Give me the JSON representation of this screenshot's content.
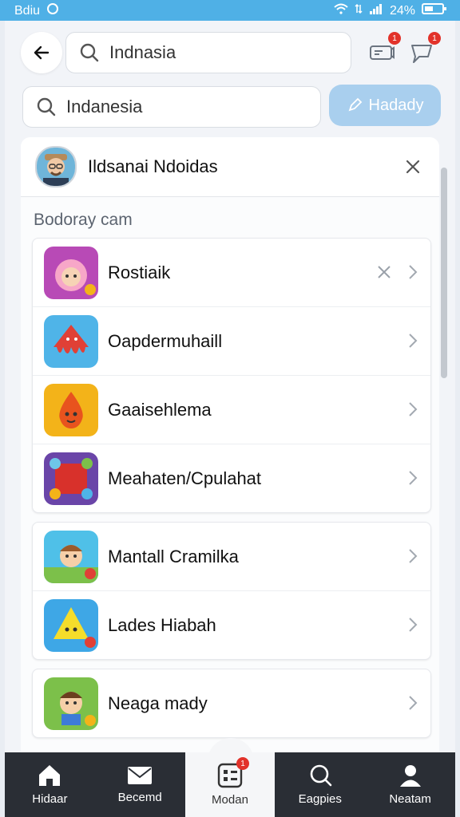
{
  "status_bar": {
    "carrier": "Bdiu",
    "battery": "24%"
  },
  "header": {
    "search_primary": {
      "value": "Indnasia",
      "placeholder": "Indnasia"
    },
    "search_secondary": {
      "value": "Indanesia",
      "placeholder": "Indanesia"
    },
    "action_button": "Hadady",
    "badges": {
      "inbox": "1",
      "notifications": "1"
    }
  },
  "user": {
    "name": "Ildsanai Ndoidas"
  },
  "section": {
    "title": "Bodoray cam"
  },
  "apps_group1": [
    {
      "label": "Rostiaik",
      "icon": "girl-app-icon",
      "color": "#b84ab6",
      "has_remove": true
    },
    {
      "label": "Oapdermuhaill",
      "icon": "squid-app-icon",
      "color": "#4fb4e8",
      "has_remove": false
    },
    {
      "label": "Gaaisehlema",
      "icon": "drop-app-icon",
      "color": "#f3b319",
      "has_remove": false
    },
    {
      "label": "Meahaten/Cpulahat",
      "icon": "gem-app-icon",
      "color": "#6a45a8",
      "has_remove": false
    }
  ],
  "apps_group2": [
    {
      "label": "Mantall Cramilka",
      "icon": "boy-app-icon",
      "color": "#4fc0e8",
      "has_remove": false
    },
    {
      "label": "Lades Hiabah",
      "icon": "triangle-app-icon",
      "color": "#3ea7e6",
      "has_remove": false
    }
  ],
  "apps_group3": [
    {
      "label": "Neaga mady",
      "icon": "kid-app-icon",
      "color": "#7cc04a",
      "has_remove": false
    }
  ],
  "bottom_nav": [
    {
      "label": "Hidaar",
      "icon": "home-icon"
    },
    {
      "label": "Becemd",
      "icon": "mail-icon"
    },
    {
      "label": "Modan",
      "icon": "grid-icon",
      "badge": "1"
    },
    {
      "label": "Eagpies",
      "icon": "search-icon"
    },
    {
      "label": "Neatam",
      "icon": "user-icon"
    }
  ],
  "colors": {
    "status_bar": "#4fb0e6",
    "accent_button": "#a9cfee",
    "nav_dark": "#2a2e35",
    "badge": "#e2322a"
  }
}
